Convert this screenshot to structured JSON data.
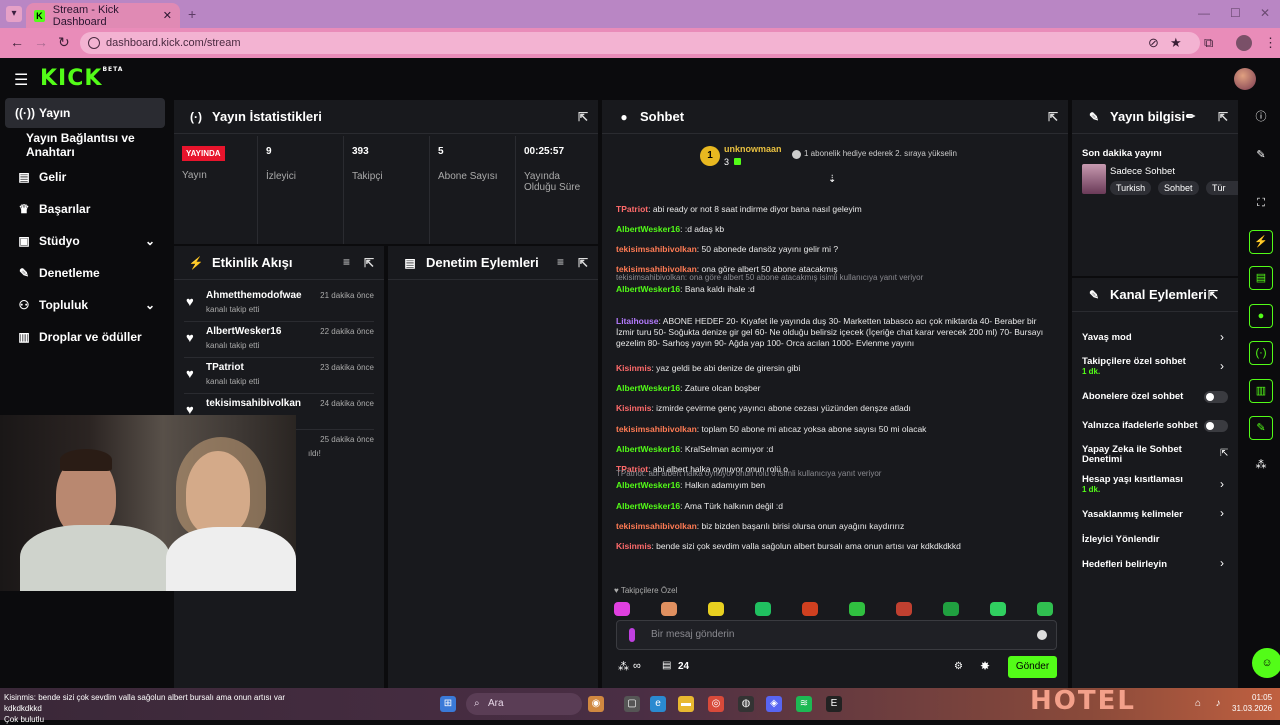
{
  "browser": {
    "tab_title": "Stream - Kick Dashboard",
    "url": "dashboard.kick.com/stream"
  },
  "brand": {
    "logo": "KICK",
    "logo_sup": "BETA",
    "accent": "#53fc18"
  },
  "sidebar": {
    "items": [
      {
        "label": "Yayın",
        "icon": "broadcast-icon"
      },
      {
        "label": "Yayın Bağlantısı ve Anahtarı",
        "icon": ""
      },
      {
        "label": "Gelir",
        "icon": "chart-icon"
      },
      {
        "label": "Başarılar",
        "icon": "trophy-icon"
      },
      {
        "label": "Stüdyo",
        "icon": "studio-icon"
      },
      {
        "label": "Denetleme",
        "icon": "wrench-icon"
      },
      {
        "label": "Topluluk",
        "icon": "community-icon"
      },
      {
        "label": "Droplar ve ödüller",
        "icon": "gift-icon"
      }
    ]
  },
  "stats": {
    "title": "Yayın İstatistikleri",
    "live_badge": "YAYINDA",
    "cells": [
      {
        "value": "",
        "label": "Yayın"
      },
      {
        "value": "9",
        "label": "İzleyici"
      },
      {
        "value": "393",
        "label": "Takipçi"
      },
      {
        "value": "5",
        "label": "Abone Sayısı"
      },
      {
        "value": "00:25:57",
        "label": "Yayında Olduğu Süre"
      }
    ]
  },
  "activity": {
    "title": "Etkinlik Akışı",
    "items": [
      {
        "name": "Ahmetthemodofwae",
        "sub": "kanalı takip etti",
        "time": "21 dakika önce"
      },
      {
        "name": "AlbertWesker16",
        "sub": "kanalı takip etti",
        "time": "22 dakika önce"
      },
      {
        "name": "TPatriot",
        "sub": "kanalı takip etti",
        "time": "23 dakika önce"
      },
      {
        "name": "tekisimsahibivolkan",
        "sub": "",
        "time": "24 dakika önce"
      },
      {
        "name": "",
        "sub": "ıldı!",
        "time": "25 dakika önce"
      }
    ]
  },
  "moderation": {
    "title": "Denetim Eylemleri"
  },
  "chat": {
    "title": "Sohbet",
    "pinned_user": "unknowmaan",
    "pinned_count": "3",
    "pinned_msg": "1 abonelik hediye ederek 2. sıraya yükselin",
    "messages": [
      {
        "user": "TPatriot",
        "color": "#ff6b6b",
        "text": "abi ready or not 8 saat indirme diyor bana nasıl geleyim",
        "reply": ""
      },
      {
        "user": "AlbertWesker16",
        "color": "#53fc18",
        "text": ":d adaş kb",
        "reply": ""
      },
      {
        "user": "tekisimsahibivolkan",
        "color": "#ff7b54",
        "text": "50 abonede dansöz yayını gelir mi ?",
        "reply": ""
      },
      {
        "user": "tekisimsahibivolkan",
        "color": "#ff7b54",
        "text": "ona göre albert 50 abone atacakmış",
        "reply": ""
      },
      {
        "user": "AlbertWesker16",
        "color": "#53fc18",
        "text": "Bana kaldı ihale :d",
        "reply": "tekisimsahibivolkan: ona göre albert 50 abone atacakmış isimli kullanıcıya yanıt veriyor"
      },
      {
        "user": "Litaihouse",
        "color": "#b57bff",
        "text": "ABONE HEDEF 20- Kıyafet ile yayında duş 30- Marketten tabasco acı çok miktarda 40- Beraber bir İzmir turu 50- Soğukta denize gir gel 60- Ne olduğu belirsiz içecek (İçeriğe chat karar verecek 200 ml) 70- Bursayı gezelim 80- Sarhoş yayın 90- Ağda yap 100- Orca acılan 1000- Evlenme yayını",
        "reply": ""
      },
      {
        "user": "Kisinmis",
        "color": "#ff6b6b",
        "text": "yaz geldi be abi denize de girersin gibi",
        "reply": ""
      },
      {
        "user": "AlbertWesker16",
        "color": "#53fc18",
        "text": "Zature olcan boşber",
        "reply": ""
      },
      {
        "user": "Kisinmis",
        "color": "#ff6b6b",
        "text": "izmirde çevirme genç yayıncı abone cezası yüzünden denşze atladı",
        "reply": ""
      },
      {
        "user": "tekisimsahibivolkan",
        "color": "#ff7b54",
        "text": "toplam 50 abone mi atıcaz yoksa abone sayısı 50 mi olacak",
        "reply": ""
      },
      {
        "user": "AlbertWesker16",
        "color": "#53fc18",
        "text": "KralSelman acımıyor :d",
        "reply": ""
      },
      {
        "user": "TPatriot",
        "color": "#ff6b6b",
        "text": "abi albert halka oynuyor onun rolü o",
        "reply": ""
      },
      {
        "user": "AlbertWesker16",
        "color": "#53fc18",
        "text": "Halkın adamıyım ben",
        "reply": "TPatriot: abi albert halka oynuyor onun rolü o isimli kullanıcıya yanıt veriyor"
      },
      {
        "user": "AlbertWesker16",
        "color": "#53fc18",
        "text": "Ama Türk halkının değil :d",
        "reply": ""
      },
      {
        "user": "tekisimsahibivolkan",
        "color": "#ff7b54",
        "text": "biz bizden başarılı birisi olursa onun ayağını kaydırırız",
        "reply": ""
      },
      {
        "user": "Kisinmis",
        "color": "#ff6b6b",
        "text": "bende sizi çok sevdim valla sağolun albert bursalı ama onun artısı var kdkdkdkkd",
        "reply": ""
      }
    ],
    "followers_label": "Takipçilere Özel",
    "input_placeholder": "Bir mesaj gönderin",
    "points": "∞",
    "count": "24",
    "send_label": "Gönder"
  },
  "stream_info": {
    "title": "Yayın bilgisi",
    "last_minute": "Son dakika yayını",
    "category": "Sadece Sohbet",
    "tags": [
      "Turkish",
      "Sohbet",
      "Tür"
    ]
  },
  "channel_actions": {
    "title": "Kanal Eylemleri",
    "rows": [
      {
        "label": "Yavaş mod",
        "sub": "",
        "control": "arrow"
      },
      {
        "label": "Takipçilere özel sohbet",
        "sub": "1 dk.",
        "control": "arrow"
      },
      {
        "label": "Abonelere özel sohbet",
        "sub": "",
        "control": "toggle"
      },
      {
        "label": "Yalnızca ifadelerle sohbet",
        "sub": "",
        "control": "toggle"
      },
      {
        "label": "Yapay Zeka ile Sohbet Denetimi",
        "sub": "",
        "control": "external"
      },
      {
        "label": "Hesap yaşı kısıtlaması",
        "sub": "1 dk.",
        "control": "arrow"
      },
      {
        "label": "Yasaklanmış kelimeler",
        "sub": "",
        "control": "arrow"
      },
      {
        "label": "İzleyici Yönlendir",
        "sub": "",
        "control": "none"
      },
      {
        "label": "Hedefleri belirleyin",
        "sub": "",
        "control": "arrow"
      }
    ]
  },
  "taskbar": {
    "ticker": "Kisinmis: bende sizi çok sevdim valla sağolun albert bursalı ama onun artısı var kdkdkdkkd",
    "weather": "Çok bulutlu",
    "search": "Ara",
    "time": "01:05",
    "date": "31.03.2026",
    "ad": "HOTEL"
  }
}
